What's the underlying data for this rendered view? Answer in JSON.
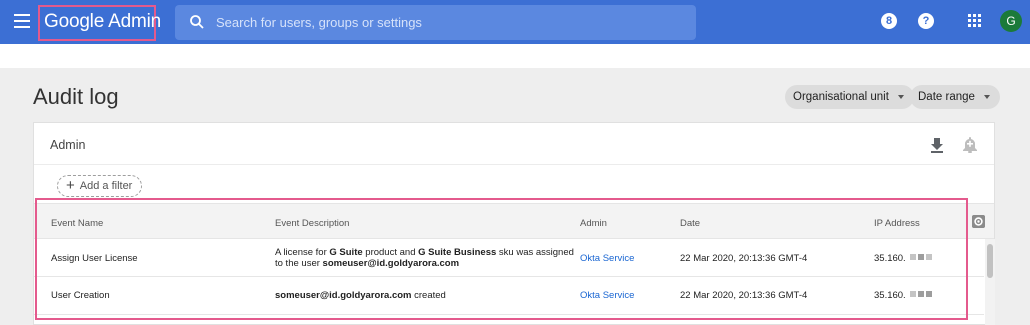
{
  "app": {
    "logo_google": "Google",
    "logo_admin": "Admin",
    "search_placeholder": "Search for users, groups or settings",
    "notification_count": "8",
    "help_label": "?",
    "avatar_initial": "G",
    "brand_color": "#3c6fd4",
    "highlight_color": "#e45a8d"
  },
  "page": {
    "title": "Audit log",
    "filters": [
      {
        "label": "Organisational unit"
      },
      {
        "label": "Date range"
      }
    ]
  },
  "card": {
    "title": "Admin",
    "add_filter_label": "Add a filter"
  },
  "table": {
    "headers": [
      "Event Name",
      "Event Description",
      "Admin",
      "Date",
      "IP Address"
    ],
    "rows": [
      {
        "event_name": "Assign User License",
        "desc_parts": [
          "A license for ",
          "G Suite",
          " product and ",
          "G Suite Business",
          " sku was assigned",
          "to the user ",
          "someuser@id.goldyarora.com"
        ],
        "admin": "Okta Service",
        "date": "22 Mar 2020, 20:13:36 GMT-4",
        "ip": "35.160."
      },
      {
        "event_name": "User Creation",
        "desc_parts": [
          "someuser@id.goldyarora.com",
          " created"
        ],
        "admin": "Okta Service",
        "date": "22 Mar 2020, 20:13:36 GMT-4",
        "ip": "35.160."
      }
    ]
  }
}
